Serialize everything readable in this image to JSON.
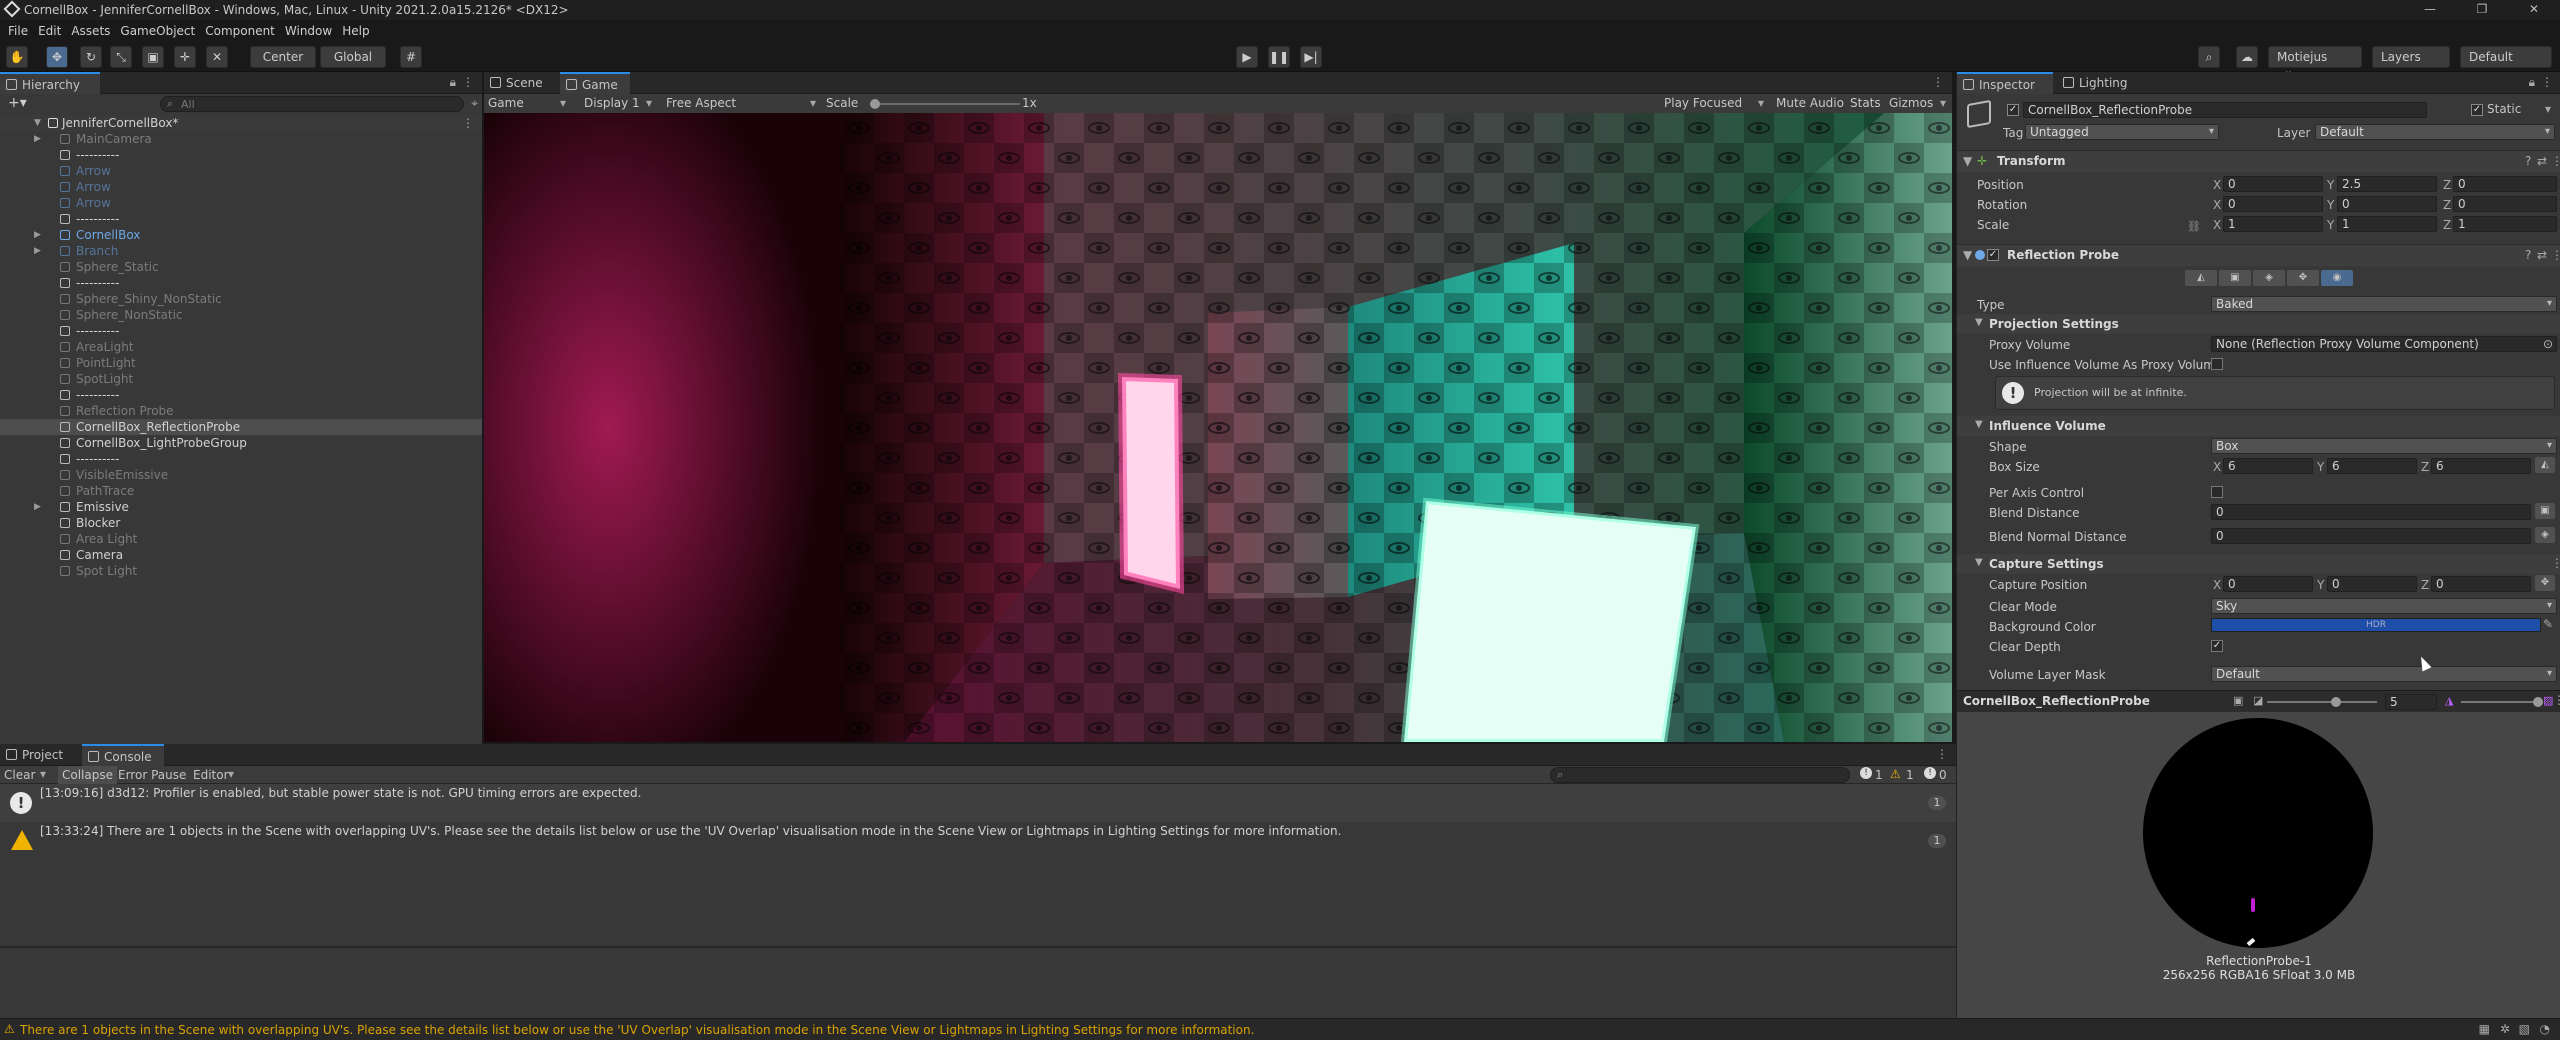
{
  "window": {
    "title": "CornellBox - JenniferCornellBox - Windows, Mac, Linux - Unity 2021.2.0a15.2126* <DX12>",
    "controls": [
      "—",
      "❐",
      "✕"
    ]
  },
  "menu": [
    "File",
    "Edit",
    "Assets",
    "GameObject",
    "Component",
    "Window",
    "Help"
  ],
  "toolbar": {
    "pivot": "Center",
    "space": "Global",
    "account": "Motiejus Vilt...",
    "layers": "Layers",
    "layout": "Default"
  },
  "hierarchy": {
    "tab": "Hierarchy",
    "search_placeholder": "All",
    "scene": "JenniferCornellBox*",
    "items": [
      {
        "label": "MainCamera",
        "style": "dim",
        "arrow": true
      },
      {
        "label": "----------",
        "style": "normal"
      },
      {
        "label": "Arrow",
        "style": "bluedim"
      },
      {
        "label": "Arrow",
        "style": "bluedim"
      },
      {
        "label": "Arrow",
        "style": "bluedim"
      },
      {
        "label": "----------",
        "style": "normal"
      },
      {
        "label": "CornellBox",
        "style": "blue",
        "arrow": true
      },
      {
        "label": "Branch",
        "style": "bluedim",
        "arrow": true
      },
      {
        "label": "Sphere_Static",
        "style": "dim"
      },
      {
        "label": "----------",
        "style": "normal"
      },
      {
        "label": "Sphere_Shiny_NonStatic",
        "style": "dim"
      },
      {
        "label": "Sphere_NonStatic",
        "style": "dim"
      },
      {
        "label": "----------",
        "style": "normal"
      },
      {
        "label": "AreaLight",
        "style": "dim"
      },
      {
        "label": "PointLight",
        "style": "dim"
      },
      {
        "label": "SpotLight",
        "style": "dim"
      },
      {
        "label": "----------",
        "style": "normal"
      },
      {
        "label": "Reflection Probe",
        "style": "dim"
      },
      {
        "label": "CornellBox_ReflectionProbe",
        "style": "sel"
      },
      {
        "label": "CornellBox_LightProbeGroup",
        "style": "normal"
      },
      {
        "label": "----------",
        "style": "normal"
      },
      {
        "label": "VisibleEmissive",
        "style": "dim"
      },
      {
        "label": "PathTrace",
        "style": "dim"
      },
      {
        "label": "Emissive",
        "style": "normal",
        "arrow": true
      },
      {
        "label": "Blocker",
        "style": "normal"
      },
      {
        "label": "Area Light",
        "style": "dim"
      },
      {
        "label": "Camera",
        "style": "normal"
      },
      {
        "label": "Spot Light",
        "style": "dim"
      }
    ]
  },
  "game": {
    "tab_scene": "Scene",
    "tab_game": "Game",
    "mode": "Game",
    "display": "Display 1",
    "aspect": "Free Aspect",
    "scale_label": "Scale",
    "scale_value": "1x",
    "scale_fraction": 0.0,
    "play_focused": "Play Focused",
    "mute": "Mute Audio",
    "stats": "Stats",
    "gizmos": "Gizmos"
  },
  "console": {
    "tab_project": "Project",
    "tab_console": "Console",
    "clear": "Clear",
    "collapse": "Collapse",
    "error_pause": "Error Pause",
    "editor": "Editor",
    "count_info": "1",
    "count_warn": "1",
    "count_err": "0",
    "messages": [
      {
        "kind": "info",
        "text": "[13:09:16] d3d12: Profiler is enabled, but stable power state is not. GPU timing errors are expected.",
        "count": "1"
      },
      {
        "kind": "warn",
        "text": "[13:33:24] There are 1 objects in the Scene with overlapping UV's. Please see the details list below or use the 'UV Overlap' visualisation mode in the Scene View or Lightmaps in Lighting Settings for more information.",
        "count": "1"
      }
    ]
  },
  "inspector": {
    "tab_inspector": "Inspector",
    "tab_lighting": "Lighting",
    "object_name": "CornellBox_ReflectionProbe",
    "static_label": "Static",
    "tag_label": "Tag",
    "tag_value": "Untagged",
    "layer_label": "Layer",
    "layer_value": "Default",
    "transform": {
      "title": "Transform",
      "rows": [
        {
          "label": "Position",
          "x": "0",
          "y": "2.5",
          "z": "0"
        },
        {
          "label": "Rotation",
          "x": "0",
          "y": "0",
          "z": "0"
        },
        {
          "label": "Scale",
          "x": "1",
          "y": "1",
          "z": "1"
        }
      ]
    },
    "probe": {
      "title": "Reflection Probe",
      "type_label": "Type",
      "type_value": "Baked",
      "projection_title": "Projection Settings",
      "proxy_label": "Proxy Volume",
      "proxy_value": "None (Reflection Proxy Volume Component)",
      "use_influence_label": "Use Influence Volume As Proxy Volume",
      "help_text": "Projection will be at infinite.",
      "influence_title": "Influence Volume",
      "shape_label": "Shape",
      "shape_value": "Box",
      "boxsize_label": "Box Size",
      "boxsize": {
        "x": "6",
        "y": "6",
        "z": "6"
      },
      "per_axis_label": "Per Axis Control",
      "blend_dist_label": "Blend Distance",
      "blend_dist_value": "0",
      "blend_normal_label": "Blend Normal Distance",
      "blend_normal_value": "0",
      "capture_title": "Capture Settings",
      "capture_pos_label": "Capture Position",
      "capture_pos": {
        "x": "0",
        "y": "0",
        "z": "0"
      },
      "clear_mode_label": "Clear Mode",
      "clear_mode_value": "Sky",
      "bg_color_label": "Background Color",
      "bg_color_hdr": "HDR",
      "bg_color": "#1d4fa8",
      "clear_depth_label": "Clear Depth",
      "volume_mask_label": "Volume Layer Mask",
      "volume_mask_value": "Default"
    },
    "preview": {
      "name": "CornellBox_ReflectionProbe",
      "exposure": "5",
      "probe_label": "ReflectionProbe-1",
      "probe_info": "256x256  RGBA16 SFloat  3.0 MB"
    }
  },
  "status": {
    "text": "There are 1 objects in the Scene with overlapping UV's. Please see the details list below or use the 'UV Overlap' visualisation mode in the Scene View or Lightmaps in Lighting Settings for more information."
  }
}
